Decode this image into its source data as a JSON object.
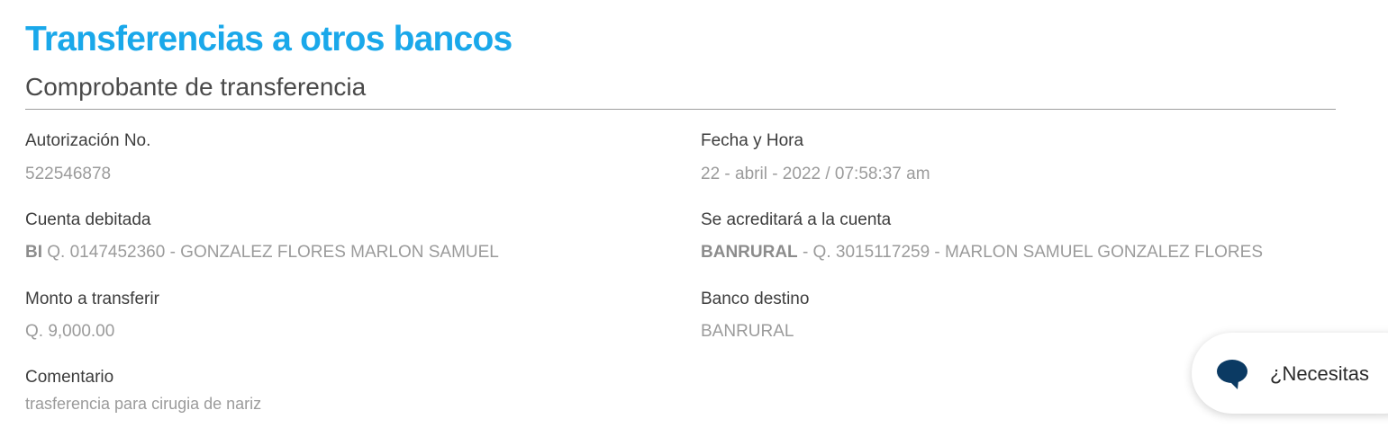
{
  "header": {
    "title": "Transferencias a otros bancos",
    "subtitle": "Comprobante de transferencia"
  },
  "fields": {
    "autorizacion": {
      "label": "Autorización No.",
      "value": "522546878"
    },
    "fecha_hora": {
      "label": "Fecha y Hora",
      "value": "22 - abril - 2022 / 07:58:37 am"
    },
    "cuenta_debitada": {
      "label": "Cuenta debitada",
      "bank": "BI",
      "value": "Q. 0147452360 - GONZALEZ FLORES MARLON SAMUEL"
    },
    "cuenta_acreditar": {
      "label": "Se acreditará a la cuenta",
      "bank": "BANRURAL",
      "value": "- Q. 3015117259 - MARLON SAMUEL GONZALEZ FLORES"
    },
    "monto": {
      "label": "Monto a transferir",
      "value": "Q. 9,000.00"
    },
    "banco_destino": {
      "label": "Banco destino",
      "value": "BANRURAL"
    },
    "comentario": {
      "label": "Comentario",
      "value": "trasferencia para cirugia de nariz"
    }
  },
  "chat": {
    "label": "¿Necesitas",
    "icon": "chat-bubble-icon"
  },
  "colors": {
    "title": "#1aa8ea",
    "chat_icon": "#0b3a63"
  }
}
